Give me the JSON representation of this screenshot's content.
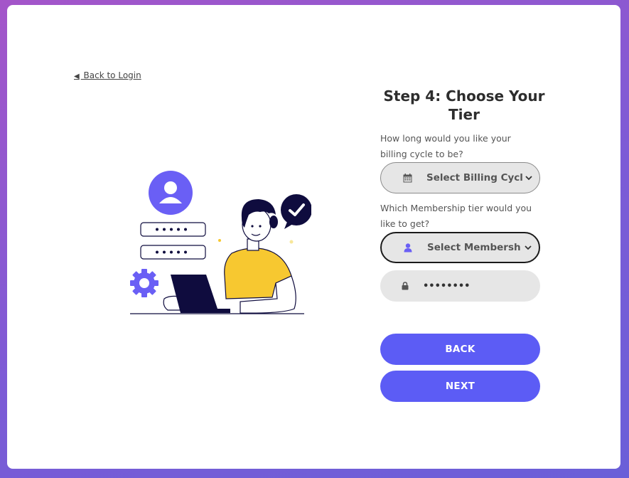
{
  "back_link": {
    "arrow": "◀",
    "label": "Back to Login"
  },
  "form": {
    "title": "Step 4: Choose Your Tier",
    "billing_question": "How long would you like your billing cycle to be?",
    "billing_select": {
      "value": "Select Billing Cycl",
      "icon": "calendar-icon"
    },
    "tier_question": "Which Membership tier would you like to get?",
    "tier_select": {
      "value": "Select Membersh",
      "icon": "user-icon"
    },
    "password": {
      "value": "••••••••",
      "icon": "lock-icon"
    },
    "back_button": "BACK",
    "next_button": "NEXT"
  },
  "colors": {
    "accent": "#5c5cf5",
    "background_gradient_start": "#a455c9",
    "background_gradient_end": "#6a5fd8",
    "illustration_yellow": "#f7c830",
    "illustration_navy": "#0f0c3e"
  }
}
